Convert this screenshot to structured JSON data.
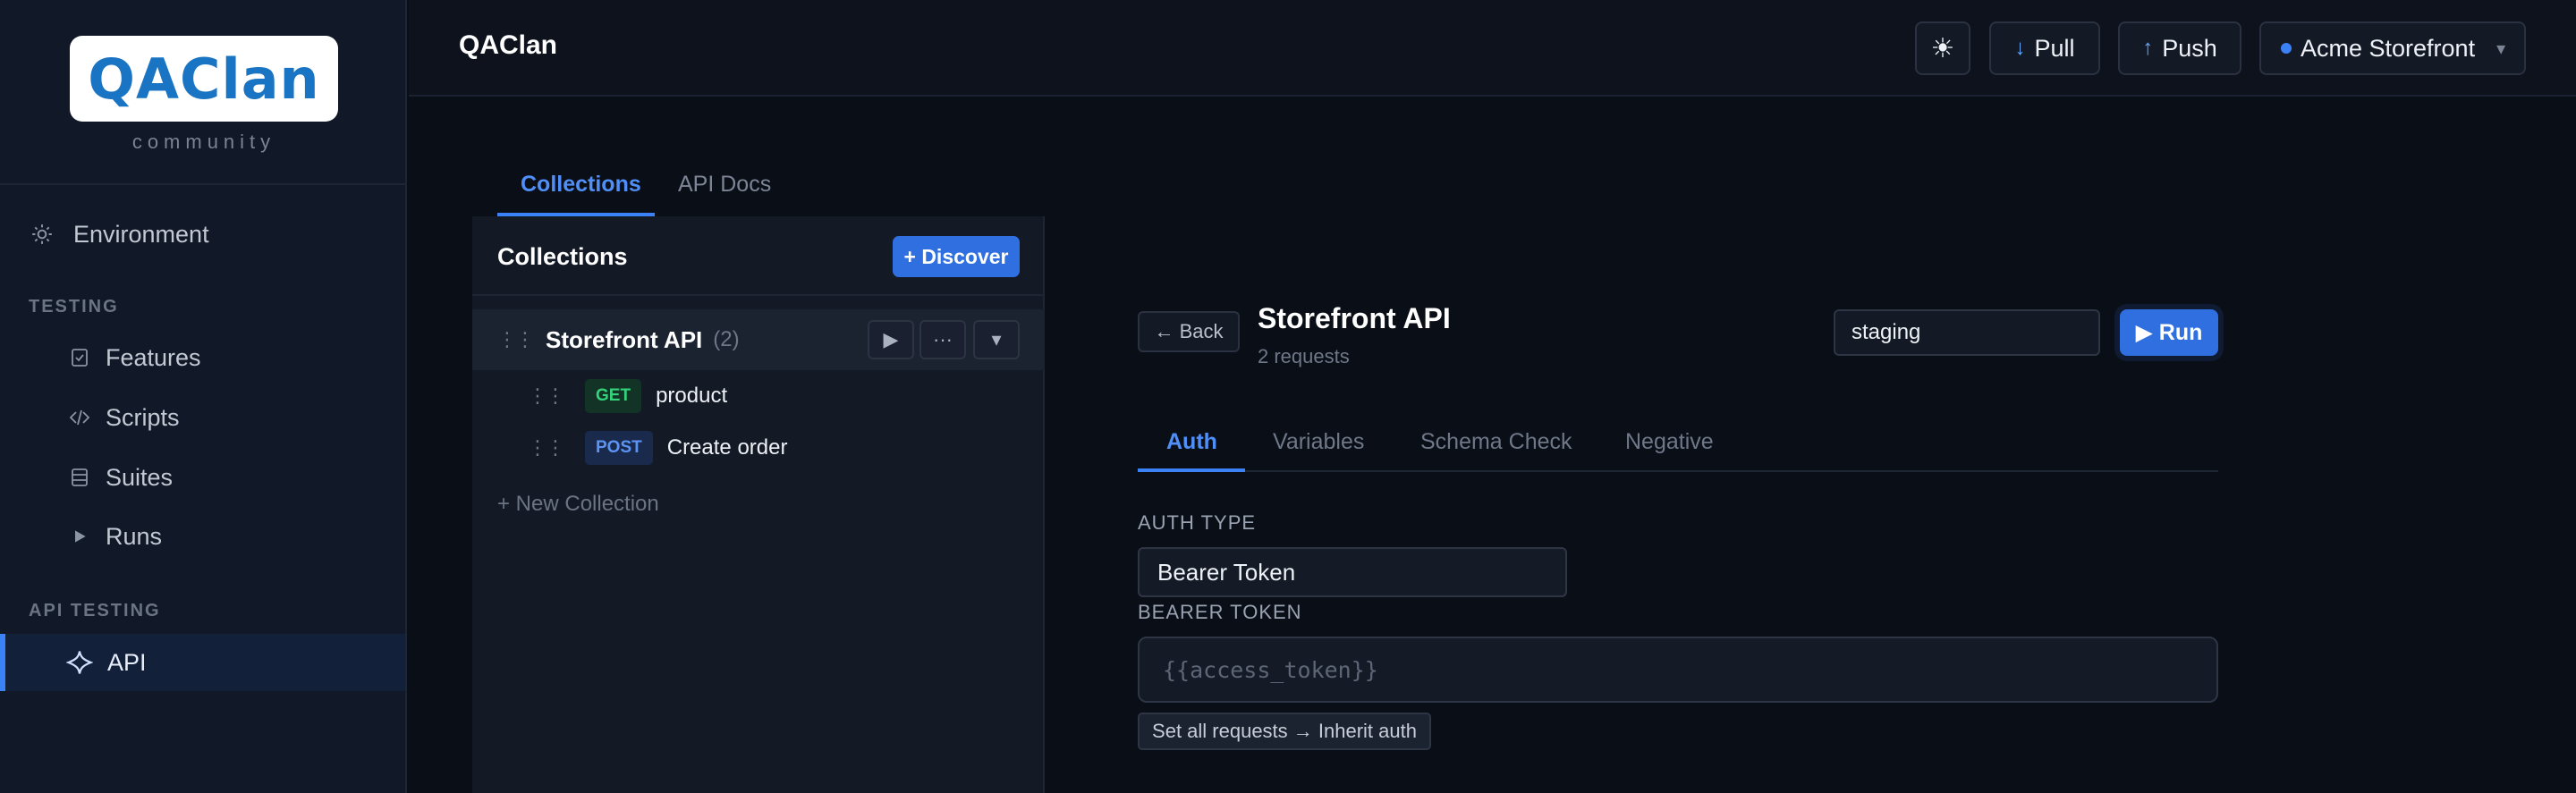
{
  "sidebar": {
    "logo": {
      "text": "QAClan",
      "sub": "community"
    },
    "environment_label": "Environment",
    "sections": {
      "testing": "TESTING",
      "api_testing": "API TESTING"
    },
    "items": [
      {
        "label": "Features",
        "icon": "features-icon"
      },
      {
        "label": "Scripts",
        "icon": "code-icon"
      },
      {
        "label": "Suites",
        "icon": "suites-icon"
      },
      {
        "label": "Runs",
        "icon": "play-icon"
      }
    ],
    "api_item": {
      "label": "API",
      "icon": "sparkle-icon",
      "active": true
    }
  },
  "topbar": {
    "title": "QAClan",
    "theme_icon": "☀",
    "pull_label": "Pull",
    "push_label": "Push",
    "workspace": "Acme Storefront",
    "workspace_chevron": "▾"
  },
  "main_tabs": [
    "Collections",
    "API Docs"
  ],
  "collections": {
    "header": "Collections",
    "discover_label": "+ Discover",
    "items": [
      {
        "name": "Storefront API",
        "count": "(2)"
      }
    ],
    "requests": [
      {
        "method": "GET",
        "name": "product"
      },
      {
        "method": "POST",
        "name": "Create order"
      }
    ],
    "new_collection_label": "+ New Collection",
    "actions": {
      "run": "▶",
      "more": "···",
      "expand": "▾"
    }
  },
  "detail": {
    "back_label": "← Back",
    "title": "Storefront API",
    "subtitle": "2 requests",
    "env_value": "staging",
    "run_label": "▶ Run",
    "tabs": [
      "Auth",
      "Variables",
      "Schema Check",
      "Negative"
    ],
    "auth_type_label": "AUTH TYPE",
    "auth_type_value": "Bearer Token",
    "bearer_label": "BEARER TOKEN",
    "bearer_placeholder": "{{access_token}}",
    "set_all_label": "Set all requests → Inherit auth"
  },
  "colors": {
    "accent": "#3b82f6",
    "background": "#0a0e17",
    "panel": "#131925",
    "get_method": "#34d27b",
    "post_method": "#5c94f4"
  }
}
